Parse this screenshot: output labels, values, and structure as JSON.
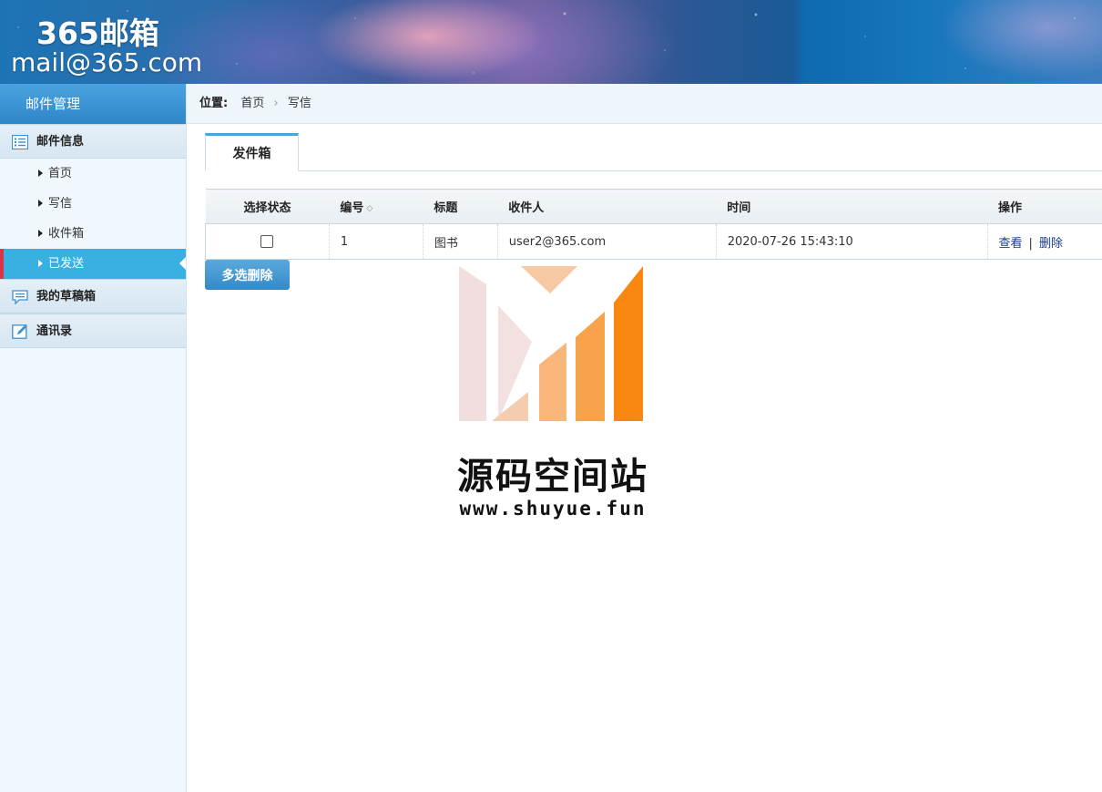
{
  "header": {
    "title": "365邮箱",
    "email": "mail@365.com"
  },
  "sidebar": {
    "title": "邮件管理",
    "groups": [
      {
        "label": "邮件信息",
        "icon": "list-icon",
        "items": [
          {
            "label": "首页"
          },
          {
            "label": "写信"
          },
          {
            "label": "收件箱"
          },
          {
            "label": "已发送",
            "active": true
          }
        ]
      },
      {
        "label": "我的草稿箱",
        "icon": "chat-icon"
      },
      {
        "label": "通讯录",
        "icon": "edit-icon"
      }
    ]
  },
  "breadcrumb": {
    "label": "位置:",
    "items": [
      "首页",
      "写信"
    ]
  },
  "tabs": [
    {
      "label": "发件箱",
      "active": true
    }
  ],
  "table": {
    "columns": [
      "选择状态",
      "编号",
      "标题",
      "收件人",
      "时间",
      "操作"
    ],
    "rows": [
      {
        "id": "1",
        "title": "图书",
        "recipient": "user2@365.com",
        "time": "2020-07-26 15:43:10",
        "actions": [
          "查看",
          "删除"
        ],
        "action_separator": "|"
      }
    ]
  },
  "bulk_delete_label": "多选删除",
  "watermark": {
    "name": "源码空间站",
    "url": "www.shuyue.fun"
  },
  "colors": {
    "sidebar_active": "#3ab0e2",
    "active_marker": "#d9344a",
    "button": "#3489c6",
    "link": "#1a3c8f"
  }
}
